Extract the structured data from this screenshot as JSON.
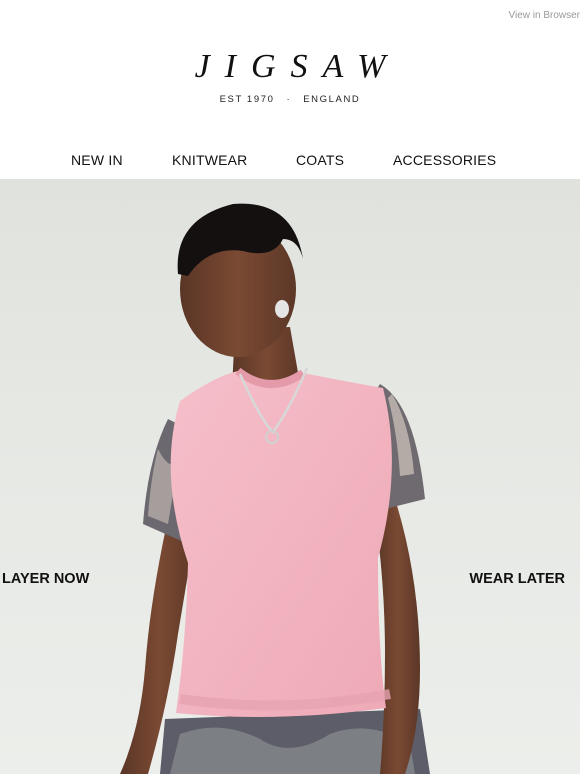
{
  "topbar": {
    "view_in_browser": "View in Browser"
  },
  "logo": {
    "wordmark": "JIGSAW",
    "est": "EST 1970",
    "separator": "·",
    "origin": "ENGLAND"
  },
  "nav": {
    "items": [
      "NEW IN",
      "KNITWEAR",
      "COATS",
      "ACCESSORIES"
    ]
  },
  "hero": {
    "left_text": "LAYER NOW",
    "right_text": "WEAR LATER"
  },
  "colors": {
    "vest": "#f2b6c1",
    "background": "#e4e6e2",
    "text": "#111111"
  }
}
